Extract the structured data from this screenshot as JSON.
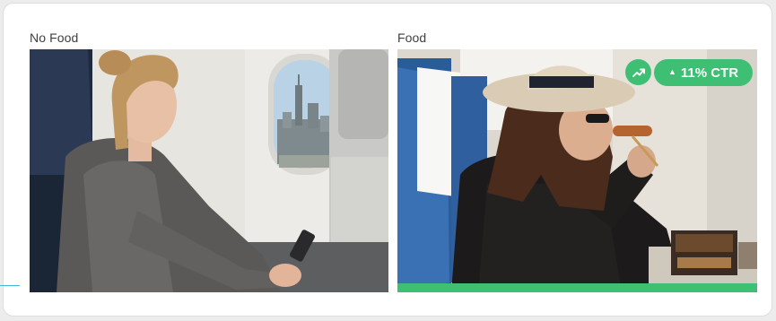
{
  "panels": {
    "left": {
      "label": "No Food"
    },
    "right": {
      "label": "Food"
    }
  },
  "badge": {
    "arrow_glyph": "▲",
    "ctr_text": "11% CTR",
    "trend_icon": "trending-up-icon"
  },
  "colors": {
    "accent_green": "#3fbf73",
    "connector_blue": "#45b6d8",
    "card_bg": "#ffffff",
    "label_text": "#3f3f3f"
  }
}
